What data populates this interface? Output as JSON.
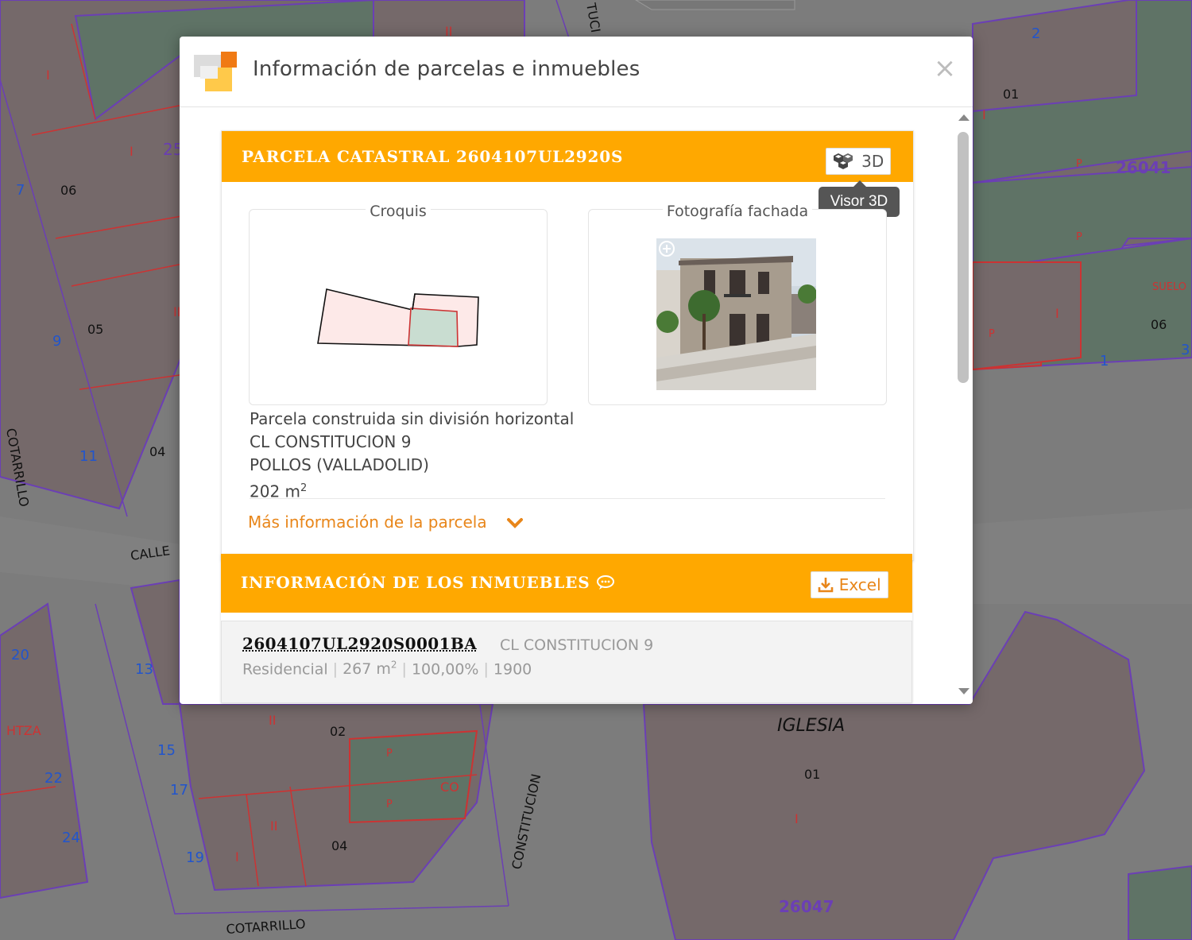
{
  "map": {
    "labels": [
      "I",
      "25",
      "7",
      "06",
      "I",
      "9",
      "05",
      "II",
      "COTARRILLO",
      "11",
      "04",
      "CALLE",
      "20",
      "13",
      "HTZA",
      "22",
      "15",
      "17",
      "24",
      "19",
      "II",
      "02",
      "P",
      "CO",
      "P",
      "II",
      "I",
      "04",
      "CONSTITUCION",
      "COTARRILLO",
      "IGLESIA",
      "01",
      "I",
      "26047",
      "2",
      "01",
      "I",
      "P",
      "26041",
      "P",
      "SUELO",
      "P",
      "I",
      "06",
      "1",
      "3",
      "TUCI",
      "II"
    ]
  },
  "modal": {
    "title": "Información de parcelas e inmuebles",
    "close_label": "×",
    "parcel": {
      "header": "PARCELA CATASTRAL 2604107UL2920S",
      "btn_3d_label": "3D",
      "tooltip": "Visor 3D",
      "croquis_label": "Croquis",
      "foto_label": "Fotografía fachada",
      "info_line1": "Parcela construida sin división horizontal",
      "info_line2": "CL CONSTITUCION 9",
      "info_line3": "POLLOS (VALLADOLID)",
      "area_value": "202 m",
      "area_sup": "2",
      "more_link": "Más información de la parcela"
    },
    "inmuebles": {
      "header": "INFORMACIÓN DE LOS INMUEBLES",
      "excel_label": "Excel",
      "rows": [
        {
          "ref": "2604107UL2920S0001BA",
          "address": "CL CONSTITUCION 9",
          "uso": "Residencial",
          "sup_value": "267 m",
          "sup_exp": "2",
          "participacion": "100,00%",
          "year": "1900"
        }
      ]
    }
  },
  "colors": {
    "accent_orange": "#ffa800",
    "link_orange": "#e8861a",
    "map_gray": "#7c7c7c",
    "parcel_green": "#5f7366",
    "parcel_brown": "#7a6d6d",
    "boundary_purple": "#6b3fb5",
    "boundary_red": "#cc3333"
  }
}
